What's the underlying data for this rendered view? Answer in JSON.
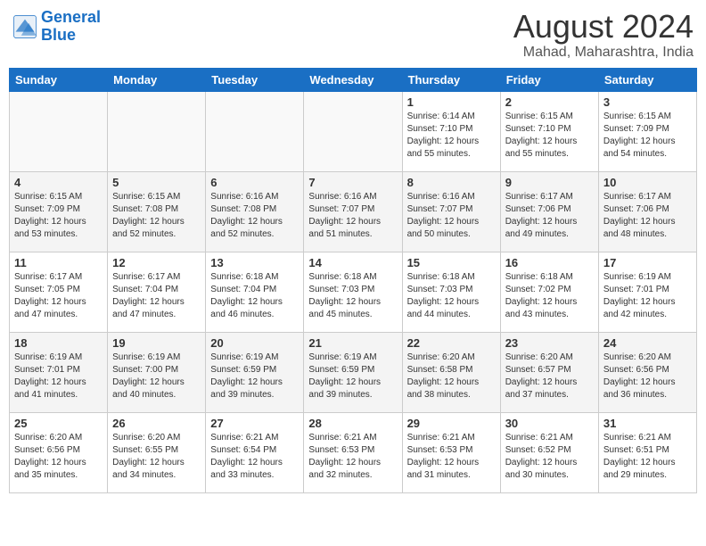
{
  "header": {
    "logo_line1": "General",
    "logo_line2": "Blue",
    "month": "August 2024",
    "location": "Mahad, Maharashtra, India"
  },
  "weekdays": [
    "Sunday",
    "Monday",
    "Tuesday",
    "Wednesday",
    "Thursday",
    "Friday",
    "Saturday"
  ],
  "weeks": [
    [
      {
        "day": "",
        "info": ""
      },
      {
        "day": "",
        "info": ""
      },
      {
        "day": "",
        "info": ""
      },
      {
        "day": "",
        "info": ""
      },
      {
        "day": "1",
        "info": "Sunrise: 6:14 AM\nSunset: 7:10 PM\nDaylight: 12 hours\nand 55 minutes."
      },
      {
        "day": "2",
        "info": "Sunrise: 6:15 AM\nSunset: 7:10 PM\nDaylight: 12 hours\nand 55 minutes."
      },
      {
        "day": "3",
        "info": "Sunrise: 6:15 AM\nSunset: 7:09 PM\nDaylight: 12 hours\nand 54 minutes."
      }
    ],
    [
      {
        "day": "4",
        "info": "Sunrise: 6:15 AM\nSunset: 7:09 PM\nDaylight: 12 hours\nand 53 minutes."
      },
      {
        "day": "5",
        "info": "Sunrise: 6:15 AM\nSunset: 7:08 PM\nDaylight: 12 hours\nand 52 minutes."
      },
      {
        "day": "6",
        "info": "Sunrise: 6:16 AM\nSunset: 7:08 PM\nDaylight: 12 hours\nand 52 minutes."
      },
      {
        "day": "7",
        "info": "Sunrise: 6:16 AM\nSunset: 7:07 PM\nDaylight: 12 hours\nand 51 minutes."
      },
      {
        "day": "8",
        "info": "Sunrise: 6:16 AM\nSunset: 7:07 PM\nDaylight: 12 hours\nand 50 minutes."
      },
      {
        "day": "9",
        "info": "Sunrise: 6:17 AM\nSunset: 7:06 PM\nDaylight: 12 hours\nand 49 minutes."
      },
      {
        "day": "10",
        "info": "Sunrise: 6:17 AM\nSunset: 7:06 PM\nDaylight: 12 hours\nand 48 minutes."
      }
    ],
    [
      {
        "day": "11",
        "info": "Sunrise: 6:17 AM\nSunset: 7:05 PM\nDaylight: 12 hours\nand 47 minutes."
      },
      {
        "day": "12",
        "info": "Sunrise: 6:17 AM\nSunset: 7:04 PM\nDaylight: 12 hours\nand 47 minutes."
      },
      {
        "day": "13",
        "info": "Sunrise: 6:18 AM\nSunset: 7:04 PM\nDaylight: 12 hours\nand 46 minutes."
      },
      {
        "day": "14",
        "info": "Sunrise: 6:18 AM\nSunset: 7:03 PM\nDaylight: 12 hours\nand 45 minutes."
      },
      {
        "day": "15",
        "info": "Sunrise: 6:18 AM\nSunset: 7:03 PM\nDaylight: 12 hours\nand 44 minutes."
      },
      {
        "day": "16",
        "info": "Sunrise: 6:18 AM\nSunset: 7:02 PM\nDaylight: 12 hours\nand 43 minutes."
      },
      {
        "day": "17",
        "info": "Sunrise: 6:19 AM\nSunset: 7:01 PM\nDaylight: 12 hours\nand 42 minutes."
      }
    ],
    [
      {
        "day": "18",
        "info": "Sunrise: 6:19 AM\nSunset: 7:01 PM\nDaylight: 12 hours\nand 41 minutes."
      },
      {
        "day": "19",
        "info": "Sunrise: 6:19 AM\nSunset: 7:00 PM\nDaylight: 12 hours\nand 40 minutes."
      },
      {
        "day": "20",
        "info": "Sunrise: 6:19 AM\nSunset: 6:59 PM\nDaylight: 12 hours\nand 39 minutes."
      },
      {
        "day": "21",
        "info": "Sunrise: 6:19 AM\nSunset: 6:59 PM\nDaylight: 12 hours\nand 39 minutes."
      },
      {
        "day": "22",
        "info": "Sunrise: 6:20 AM\nSunset: 6:58 PM\nDaylight: 12 hours\nand 38 minutes."
      },
      {
        "day": "23",
        "info": "Sunrise: 6:20 AM\nSunset: 6:57 PM\nDaylight: 12 hours\nand 37 minutes."
      },
      {
        "day": "24",
        "info": "Sunrise: 6:20 AM\nSunset: 6:56 PM\nDaylight: 12 hours\nand 36 minutes."
      }
    ],
    [
      {
        "day": "25",
        "info": "Sunrise: 6:20 AM\nSunset: 6:56 PM\nDaylight: 12 hours\nand 35 minutes."
      },
      {
        "day": "26",
        "info": "Sunrise: 6:20 AM\nSunset: 6:55 PM\nDaylight: 12 hours\nand 34 minutes."
      },
      {
        "day": "27",
        "info": "Sunrise: 6:21 AM\nSunset: 6:54 PM\nDaylight: 12 hours\nand 33 minutes."
      },
      {
        "day": "28",
        "info": "Sunrise: 6:21 AM\nSunset: 6:53 PM\nDaylight: 12 hours\nand 32 minutes."
      },
      {
        "day": "29",
        "info": "Sunrise: 6:21 AM\nSunset: 6:53 PM\nDaylight: 12 hours\nand 31 minutes."
      },
      {
        "day": "30",
        "info": "Sunrise: 6:21 AM\nSunset: 6:52 PM\nDaylight: 12 hours\nand 30 minutes."
      },
      {
        "day": "31",
        "info": "Sunrise: 6:21 AM\nSunset: 6:51 PM\nDaylight: 12 hours\nand 29 minutes."
      }
    ]
  ]
}
